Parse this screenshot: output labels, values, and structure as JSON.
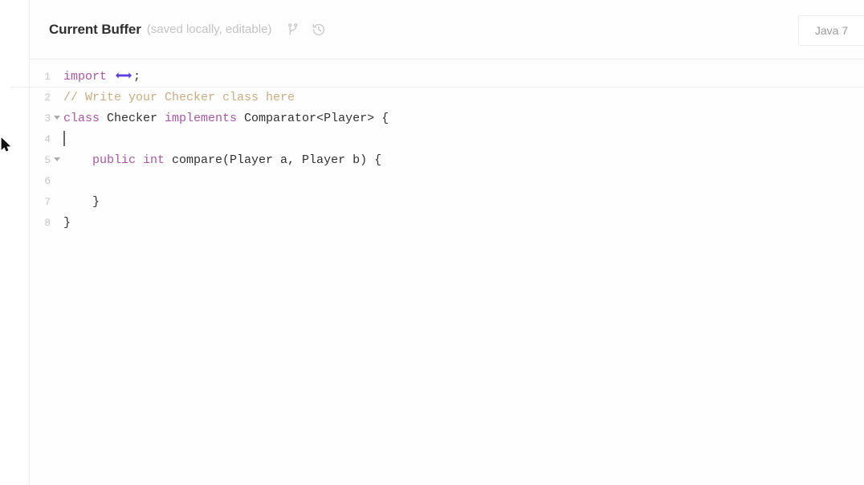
{
  "header": {
    "title": "Current Buffer",
    "subtitle": "(saved locally, editable)",
    "icons": [
      {
        "name": "git-branch-icon",
        "glyph": "branch"
      },
      {
        "name": "history-icon",
        "glyph": "history"
      }
    ],
    "language_badge": "Java 7"
  },
  "editor": {
    "language": "Java 7",
    "caret_line": 4,
    "colors": {
      "keyword": "#a857a3",
      "comment": "#c9ad80",
      "plain": "#30302f",
      "line_number": "#c6c6c6",
      "fold_arrow": "#acacac",
      "folded_marker": "#5b3fd6",
      "divider": "#efefef"
    },
    "lines": [
      {
        "number": "1",
        "fold": "",
        "separator": "below",
        "tokens": [
          {
            "type": "keyword",
            "text": "import "
          },
          {
            "type": "folded",
            "text": "↔"
          },
          {
            "type": "plain",
            "text": ";"
          }
        ]
      },
      {
        "number": "2",
        "fold": "",
        "separator": "",
        "tokens": [
          {
            "type": "comment",
            "text": "// Write your Checker class here"
          }
        ]
      },
      {
        "number": "3",
        "fold": "triangle",
        "separator": "",
        "tokens": [
          {
            "type": "keyword",
            "text": "class"
          },
          {
            "type": "plain",
            "text": " Checker "
          },
          {
            "type": "keyword",
            "text": "implements"
          },
          {
            "type": "plain",
            "text": " Comparator<Player> {"
          }
        ]
      },
      {
        "number": "4",
        "fold": "",
        "separator": "",
        "tokens": [
          {
            "type": "caret",
            "text": ""
          }
        ]
      },
      {
        "number": "5",
        "fold": "triangle",
        "separator": "",
        "tokens": [
          {
            "type": "plain",
            "text": "    "
          },
          {
            "type": "keyword",
            "text": "public int"
          },
          {
            "type": "plain",
            "text": " compare(Player a, Player b) {"
          }
        ]
      },
      {
        "number": "6",
        "fold": "",
        "separator": "",
        "tokens": [
          {
            "type": "plain",
            "text": ""
          }
        ]
      },
      {
        "number": "7",
        "fold": "",
        "separator": "",
        "tokens": [
          {
            "type": "plain",
            "text": "    }"
          }
        ]
      },
      {
        "number": "8",
        "fold": "",
        "separator": "",
        "tokens": [
          {
            "type": "plain",
            "text": "}"
          }
        ]
      }
    ]
  }
}
